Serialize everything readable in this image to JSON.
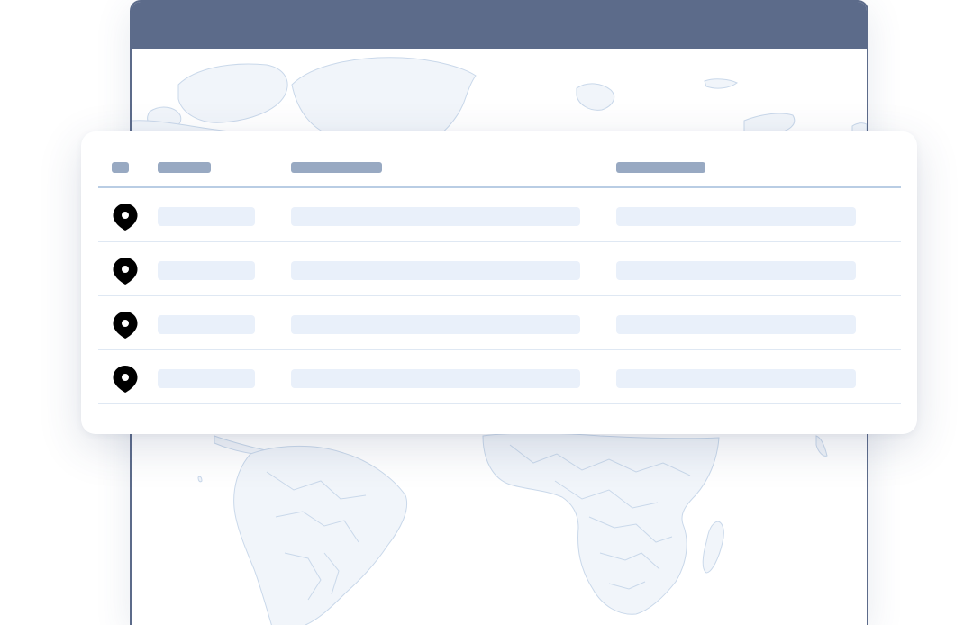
{
  "colors": {
    "window_frame": "#5c6b8a",
    "header_placeholder": "#98a9c2",
    "cell_placeholder": "#e9f0fa",
    "header_divider": "#b9cde4",
    "row_divider": "#dfe8f3",
    "map_land": "#f1f5fa",
    "map_border": "#c9d8ea",
    "pin": "#000000"
  },
  "table": {
    "columns": [
      "",
      "",
      "",
      ""
    ],
    "rows": [
      {
        "icon": "map-pin-icon",
        "cells": [
          "",
          "",
          ""
        ]
      },
      {
        "icon": "map-pin-icon",
        "cells": [
          "",
          "",
          ""
        ]
      },
      {
        "icon": "map-pin-icon",
        "cells": [
          "",
          "",
          ""
        ]
      },
      {
        "icon": "map-pin-icon",
        "cells": [
          "",
          "",
          ""
        ]
      }
    ]
  },
  "background": {
    "icon": "world-map"
  }
}
